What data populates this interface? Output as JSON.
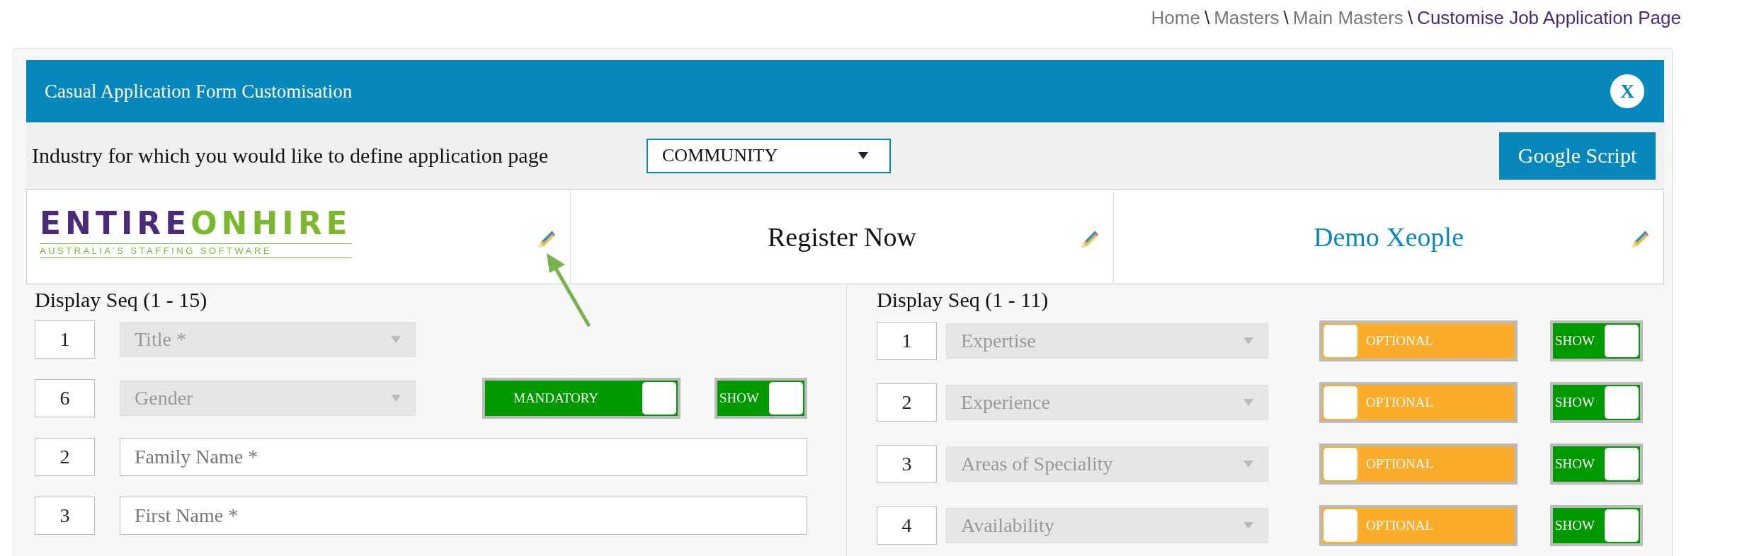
{
  "breadcrumb": [
    {
      "label": "Home",
      "kind": "link"
    },
    {
      "label": "\\",
      "kind": "separator"
    },
    {
      "label": "Masters",
      "kind": "link"
    },
    {
      "label": "\\",
      "kind": "separator"
    },
    {
      "label": "Main Masters",
      "kind": "link"
    },
    {
      "label": "\\",
      "kind": "separator"
    },
    {
      "label": "Customise Job Application Page",
      "kind": "current"
    }
  ],
  "panel": {
    "title": "Casual Application Form Customisation",
    "close_label": "X",
    "industry_label": "Industry for which you would like to define application page",
    "industry_value": "COMMUNITY",
    "script_button": "Google Script"
  },
  "header_cells": [
    {
      "kind": "logo",
      "wordmark_first": "ENTIRE",
      "wordmark_second": "ONHIRE",
      "tagline": "AUSTRALIA’S STAFFING SOFTWARE"
    },
    {
      "kind": "heading",
      "text": "Register Now"
    },
    {
      "kind": "company",
      "text": "Demo Xeople"
    }
  ],
  "columns": [
    {
      "seq_label": "Display Seq (1 - 15)",
      "fields": [
        {
          "seq": "1",
          "kind": "select",
          "label": "Title *",
          "disabled": true
        },
        {
          "seq": "6",
          "kind": "select",
          "label": "Gender",
          "disabled": true,
          "requirement": {
            "label": "MANDATORY",
            "mandatory": true
          },
          "visibility": {
            "label": "SHOW",
            "on": true
          }
        },
        {
          "seq": "2",
          "kind": "text",
          "placeholder": "Family Name *"
        },
        {
          "seq": "3",
          "kind": "text",
          "placeholder": "First Name *"
        }
      ]
    },
    {
      "seq_label": "Display Seq (1 - 11)",
      "fields": [
        {
          "seq": "1",
          "kind": "select",
          "label": "Expertise",
          "disabled": true,
          "requirement": {
            "label": "OPTIONAL",
            "mandatory": false
          },
          "visibility": {
            "label": "SHOW",
            "on": true
          }
        },
        {
          "seq": "2",
          "kind": "select",
          "label": "Experience",
          "disabled": true,
          "requirement": {
            "label": "OPTIONAL",
            "mandatory": false
          },
          "visibility": {
            "label": "SHOW",
            "on": true
          }
        },
        {
          "seq": "3",
          "kind": "select",
          "label": "Areas of Speciality",
          "disabled": true,
          "requirement": {
            "label": "OPTIONAL",
            "mandatory": false
          },
          "visibility": {
            "label": "SHOW",
            "on": true
          }
        },
        {
          "seq": "4",
          "kind": "select",
          "label": "Availability",
          "disabled": true,
          "requirement": {
            "label": "OPTIONAL",
            "mandatory": false
          },
          "visibility": {
            "label": "SHOW",
            "on": true
          }
        }
      ]
    }
  ]
}
